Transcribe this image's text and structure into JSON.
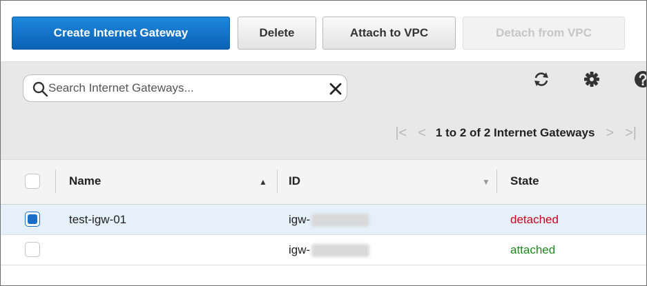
{
  "toolbar": {
    "create_label": "Create Internet Gateway",
    "delete_label": "Delete",
    "attach_label": "Attach to VPC",
    "detach_label": "Detach from VPC"
  },
  "search": {
    "placeholder": "Search Internet Gateways...",
    "value": ""
  },
  "icons": {
    "search": "search-icon",
    "clear": "close-icon",
    "refresh": "refresh-icon",
    "settings": "gear-icon",
    "help": "help-icon"
  },
  "pager": {
    "first": "|<",
    "prev": "<",
    "summary": "1 to 2 of 2 Internet Gateways",
    "next": ">",
    "last": ">|"
  },
  "table": {
    "columns": [
      "Name",
      "ID",
      "State"
    ],
    "rows": [
      {
        "selected": true,
        "name": "test-igw-01",
        "id_prefix": "igw-",
        "state": "detached"
      },
      {
        "selected": false,
        "name": "",
        "id_prefix": "igw-",
        "state": "attached"
      }
    ]
  },
  "colors": {
    "primary": "#0a62b4",
    "detached": "#d0021b",
    "attached": "#1d8a1d",
    "selected_row": "#e6f0fb"
  }
}
